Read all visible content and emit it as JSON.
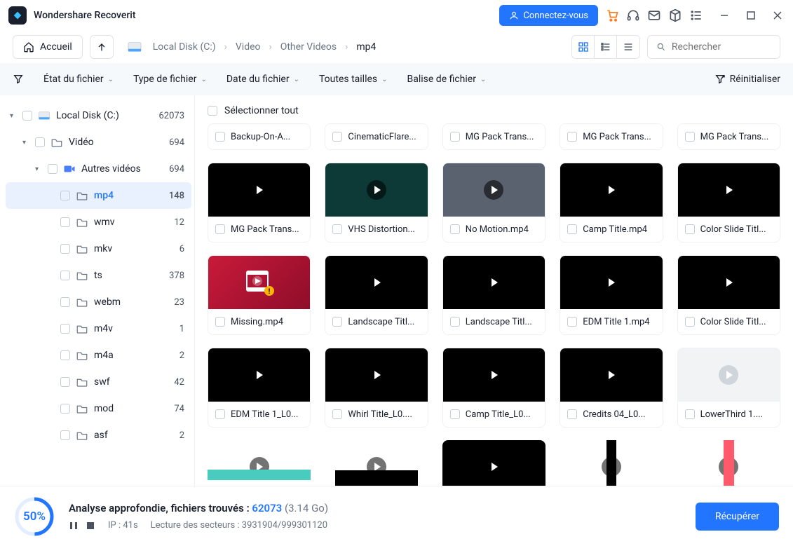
{
  "app": {
    "title": "Wondershare Recoverit",
    "connect_label": "Connectez-vous"
  },
  "toolbar": {
    "home_label": "Accueil"
  },
  "breadcrumb": [
    "Local Disk (C:)",
    "Video",
    "Other Videos",
    "mp4"
  ],
  "search": {
    "placeholder": "Rechercher"
  },
  "filters": {
    "funnel": "",
    "file_state": "État du fichier",
    "file_type": "Type de fichier",
    "file_date": "Date du fichier",
    "all_sizes": "Toutes tailles",
    "file_tag": "Balise de fichier",
    "reset": "Réinitialiser"
  },
  "sidebar": [
    {
      "indent": 0,
      "chev": "▾",
      "icon": "disk",
      "label": "Local Disk (C:)",
      "count": "62073"
    },
    {
      "indent": 1,
      "chev": "▾",
      "icon": "folder",
      "label": "Vidéo",
      "count": "694"
    },
    {
      "indent": 2,
      "chev": "▾",
      "icon": "video",
      "label": "Autres vidéos",
      "count": "694"
    },
    {
      "indent": 3,
      "chev": "",
      "icon": "folder",
      "label": "mp4",
      "count": "148",
      "selected": true
    },
    {
      "indent": 3,
      "chev": "",
      "icon": "folder",
      "label": "wmv",
      "count": "12"
    },
    {
      "indent": 3,
      "chev": "",
      "icon": "folder",
      "label": "mkv",
      "count": "6"
    },
    {
      "indent": 3,
      "chev": "",
      "icon": "folder",
      "label": "ts",
      "count": "378"
    },
    {
      "indent": 3,
      "chev": "",
      "icon": "folder",
      "label": "webm",
      "count": "23"
    },
    {
      "indent": 3,
      "chev": "",
      "icon": "folder",
      "label": "m4v",
      "count": "1"
    },
    {
      "indent": 3,
      "chev": "",
      "icon": "folder",
      "label": "m4a",
      "count": "2"
    },
    {
      "indent": 3,
      "chev": "",
      "icon": "folder",
      "label": "swf",
      "count": "42"
    },
    {
      "indent": 3,
      "chev": "",
      "icon": "folder",
      "label": "mod",
      "count": "74"
    },
    {
      "indent": 3,
      "chev": "",
      "icon": "folder",
      "label": "asf",
      "count": "2"
    }
  ],
  "grid": {
    "select_all_label": "Sélectionner tout",
    "row0": [
      "Backup-On-A...",
      "CinematicFlare...",
      "MG Pack Trans...",
      "MG Pack Trans...",
      "MG Pack Trans..."
    ],
    "items": [
      {
        "name": "MG Pack Trans...",
        "thumb": "black"
      },
      {
        "name": "VHS Distortion...",
        "thumb": "green"
      },
      {
        "name": "No Motion.mp4",
        "thumb": "grayblue"
      },
      {
        "name": "Camp Title.mp4",
        "thumb": "black"
      },
      {
        "name": "Color Slide Titl...",
        "thumb": "black"
      },
      {
        "name": "Missing.mp4",
        "thumb": "red",
        "missing": true
      },
      {
        "name": "Landscape Titl...",
        "thumb": "black"
      },
      {
        "name": "Landscape Titl...",
        "thumb": "black"
      },
      {
        "name": "EDM Title 1.mp4",
        "thumb": "black"
      },
      {
        "name": "Color Slide Titl...",
        "thumb": "black"
      },
      {
        "name": "EDM Title 1_L0...",
        "thumb": "black"
      },
      {
        "name": "Whirl Title_L0....",
        "thumb": "black"
      },
      {
        "name": "Camp Title_L0...",
        "thumb": "black"
      },
      {
        "name": "Credits 04_L0...",
        "thumb": "black"
      },
      {
        "name": "LowerThird 1....",
        "thumb": "lightgray"
      },
      {
        "name": "",
        "thumb": "teal",
        "partial": true
      },
      {
        "name": "",
        "thumb": "blackstrip1",
        "partial": true
      },
      {
        "name": "",
        "thumb": "black",
        "partial": true
      },
      {
        "name": "",
        "thumb": "whiteblack",
        "partial": true
      },
      {
        "name": "",
        "thumb": "whitered",
        "partial": true
      }
    ]
  },
  "footer": {
    "percent": "50%",
    "line1_prefix": "Analyse approfondie, fichiers trouvés : ",
    "count": "62073",
    "size": "(3.14 Go)",
    "ip_label": "IP : 41s",
    "sectors": "Lecture des secteurs : 3931904/999301120",
    "recover_label": "Récupérer"
  }
}
